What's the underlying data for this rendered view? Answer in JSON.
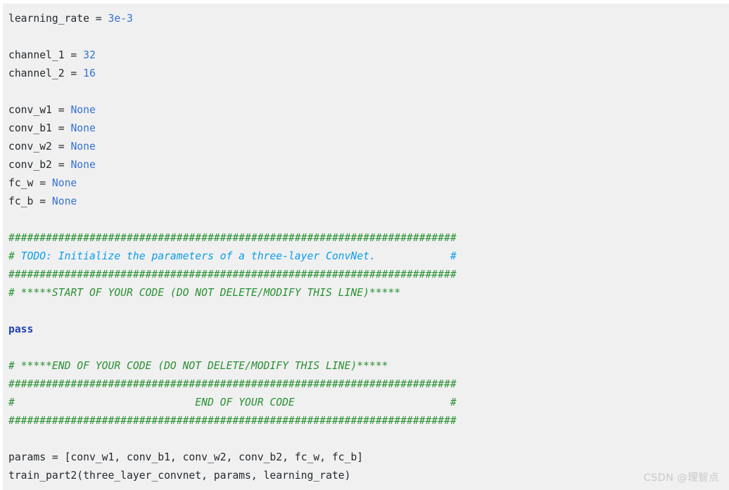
{
  "watermark": {
    "text": "CSDN @理智点",
    "color": "#c9c9c9"
  },
  "colors": {
    "background": "#f0f0f0",
    "page": "#ffffff",
    "plain_text": "#24292e",
    "literal": "#3572d3",
    "keyword": "#1f41b0",
    "comment_green": "#2a9134",
    "comment_blue": "#0b9ded"
  },
  "code": {
    "language": "python",
    "lines": [
      {
        "id": "line-1",
        "segments": [
          {
            "t": "learning_rate = ",
            "c": "plain"
          },
          {
            "t": "3e-3",
            "c": "literal"
          }
        ]
      },
      {
        "id": "line-2",
        "segments": []
      },
      {
        "id": "line-3",
        "segments": [
          {
            "t": "channel_1 = ",
            "c": "plain"
          },
          {
            "t": "32",
            "c": "literal"
          }
        ]
      },
      {
        "id": "line-4",
        "segments": [
          {
            "t": "channel_2 = ",
            "c": "plain"
          },
          {
            "t": "16",
            "c": "literal"
          }
        ]
      },
      {
        "id": "line-5",
        "segments": []
      },
      {
        "id": "line-6",
        "segments": [
          {
            "t": "conv_w1 = ",
            "c": "plain"
          },
          {
            "t": "None",
            "c": "literal"
          }
        ]
      },
      {
        "id": "line-7",
        "segments": [
          {
            "t": "conv_b1 = ",
            "c": "plain"
          },
          {
            "t": "None",
            "c": "literal"
          }
        ]
      },
      {
        "id": "line-8",
        "segments": [
          {
            "t": "conv_w2 = ",
            "c": "plain"
          },
          {
            "t": "None",
            "c": "literal"
          }
        ]
      },
      {
        "id": "line-9",
        "segments": [
          {
            "t": "conv_b2 = ",
            "c": "plain"
          },
          {
            "t": "None",
            "c": "literal"
          }
        ]
      },
      {
        "id": "line-10",
        "segments": [
          {
            "t": "fc_w = ",
            "c": "plain"
          },
          {
            "t": "None",
            "c": "literal"
          }
        ]
      },
      {
        "id": "line-11",
        "segments": [
          {
            "t": "fc_b = ",
            "c": "plain"
          },
          {
            "t": "None",
            "c": "literal"
          }
        ]
      },
      {
        "id": "line-12",
        "segments": []
      },
      {
        "id": "line-13",
        "segments": [
          {
            "t": "########################################################################",
            "c": "hash"
          }
        ]
      },
      {
        "id": "line-14",
        "segments": [
          {
            "t": "#",
            "c": "hash"
          },
          {
            "t": " TODO: Initialize the parameters of a three-layer ConvNet.            #",
            "c": "todo"
          }
        ]
      },
      {
        "id": "line-15",
        "segments": [
          {
            "t": "########################################################################",
            "c": "hash"
          }
        ]
      },
      {
        "id": "line-16",
        "segments": [
          {
            "t": "# *****START OF YOUR CODE (DO NOT DELETE/MODIFY THIS LINE)*****",
            "c": "comment"
          }
        ]
      },
      {
        "id": "line-17",
        "segments": []
      },
      {
        "id": "line-18",
        "segments": [
          {
            "t": "pass",
            "c": "keyword"
          }
        ]
      },
      {
        "id": "line-19",
        "segments": []
      },
      {
        "id": "line-20",
        "segments": [
          {
            "t": "# *****END OF YOUR CODE (DO NOT DELETE/MODIFY THIS LINE)*****",
            "c": "comment"
          }
        ]
      },
      {
        "id": "line-21",
        "segments": [
          {
            "t": "########################################################################",
            "c": "hash"
          }
        ]
      },
      {
        "id": "line-22",
        "segments": [
          {
            "t": "#                             END OF YOUR CODE                         #",
            "c": "comment"
          }
        ]
      },
      {
        "id": "line-23",
        "segments": [
          {
            "t": "########################################################################",
            "c": "hash"
          }
        ]
      },
      {
        "id": "line-24",
        "segments": []
      },
      {
        "id": "line-25",
        "segments": [
          {
            "t": "params = [conv_w1, conv_b1, conv_w2, conv_b2, fc_w, fc_b]",
            "c": "plain"
          }
        ]
      },
      {
        "id": "line-26",
        "segments": [
          {
            "t": "train_part2(three_layer_convnet, params, learning_rate)",
            "c": "plain"
          }
        ]
      }
    ]
  }
}
